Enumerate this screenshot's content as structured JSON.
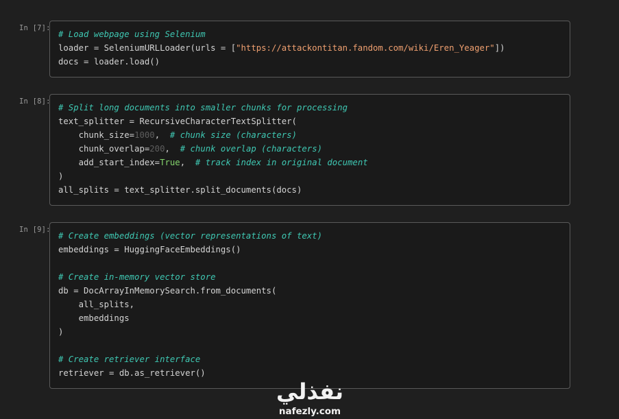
{
  "cells": [
    {
      "prompt": "In [7]:",
      "lines": [
        [
          {
            "t": "c",
            "v": "# Load webpage using Selenium"
          }
        ],
        [
          {
            "t": "o",
            "v": "loader = SeleniumURLLoader(urls = ["
          },
          {
            "t": "s",
            "v": "\"https://attackontitan.fandom.com/wiki/Eren_Yeager\""
          },
          {
            "t": "o",
            "v": "])"
          }
        ],
        [
          {
            "t": "o",
            "v": "docs = loader.load()"
          }
        ]
      ]
    },
    {
      "prompt": "In [8]:",
      "lines": [
        [
          {
            "t": "c",
            "v": "# Split long documents into smaller chunks for processing"
          }
        ],
        [
          {
            "t": "o",
            "v": "text_splitter = RecursiveCharacterTextSplitter("
          }
        ],
        [
          {
            "t": "o",
            "v": "    chunk_size="
          },
          {
            "t": "n",
            "v": "1000"
          },
          {
            "t": "o",
            "v": ",  "
          },
          {
            "t": "c",
            "v": "# chunk size (characters)"
          }
        ],
        [
          {
            "t": "o",
            "v": "    chunk_overlap="
          },
          {
            "t": "n",
            "v": "200"
          },
          {
            "t": "o",
            "v": ",  "
          },
          {
            "t": "c",
            "v": "# chunk overlap (characters)"
          }
        ],
        [
          {
            "t": "o",
            "v": "    add_start_index="
          },
          {
            "t": "k",
            "v": "True"
          },
          {
            "t": "o",
            "v": ",  "
          },
          {
            "t": "c",
            "v": "# track index in original document"
          }
        ],
        [
          {
            "t": "o",
            "v": ")"
          }
        ],
        [
          {
            "t": "o",
            "v": "all_splits = text_splitter.split_documents(docs)"
          }
        ]
      ]
    },
    {
      "prompt": "In [9]:",
      "lines": [
        [
          {
            "t": "c",
            "v": "# Create embeddings (vector representations of text)"
          }
        ],
        [
          {
            "t": "o",
            "v": "embeddings = HuggingFaceEmbeddings()"
          }
        ],
        [],
        [
          {
            "t": "c",
            "v": "# Create in-memory vector store"
          }
        ],
        [
          {
            "t": "o",
            "v": "db = DocArrayInMemorySearch.from_documents("
          }
        ],
        [
          {
            "t": "o",
            "v": "    all_splits,"
          }
        ],
        [
          {
            "t": "o",
            "v": "    embeddings"
          }
        ],
        [
          {
            "t": "o",
            "v": ")"
          }
        ],
        [],
        [
          {
            "t": "c",
            "v": "# Create retriever interface"
          }
        ],
        [
          {
            "t": "o",
            "v": "retriever = db.as_retriever()"
          }
        ]
      ]
    }
  ],
  "watermark": {
    "arabic": "نفذلي",
    "latin": "nafezly.com"
  }
}
